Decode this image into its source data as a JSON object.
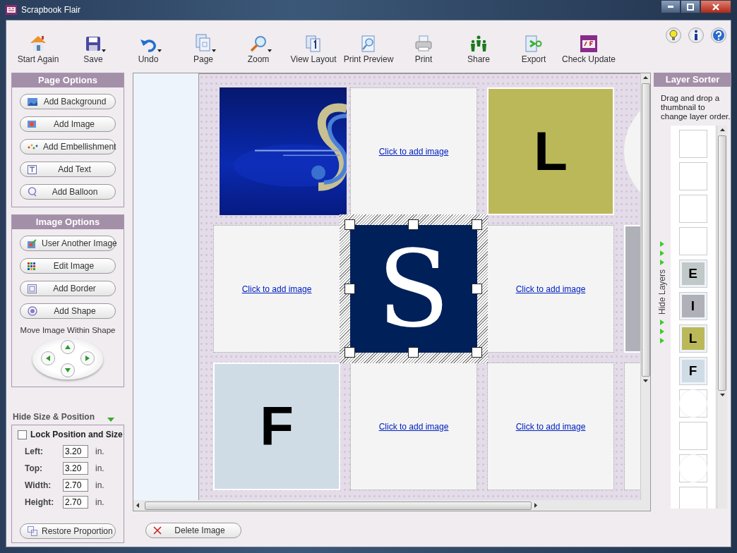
{
  "window": {
    "title": "Scrapbook Flair"
  },
  "toolbar": [
    {
      "label": "Start Again",
      "dropdown": false
    },
    {
      "label": "Save",
      "dropdown": true
    },
    {
      "label": "Undo",
      "dropdown": true
    },
    {
      "label": "Page",
      "dropdown": true
    },
    {
      "label": "Zoom",
      "dropdown": true
    },
    {
      "label": "View Layout",
      "dropdown": false
    },
    {
      "label": "Print Preview",
      "dropdown": false
    },
    {
      "label": "Print",
      "dropdown": false
    },
    {
      "label": "Share",
      "dropdown": false
    },
    {
      "label": "Export",
      "dropdown": false
    },
    {
      "label": "Check Update",
      "dropdown": false
    }
  ],
  "page_options": {
    "title": "Page Options",
    "buttons": [
      "Add Background",
      "Add Image",
      "Add Embellishment",
      "Add Text",
      "Add Balloon"
    ]
  },
  "image_options": {
    "title": "Image Options",
    "buttons": [
      "User Another Image",
      "Edit Image",
      "Add Border",
      "Add Shape"
    ],
    "move_label": "Move Image Within Shape"
  },
  "size_position": {
    "toggle_label": "Hide Size & Position",
    "lock": {
      "label": "Lock Position and Size",
      "checked": false
    },
    "fields": [
      {
        "label": "Left:",
        "value": "3.20",
        "unit": "in."
      },
      {
        "label": "Top:",
        "value": "3.20",
        "unit": "in."
      },
      {
        "label": "Width:",
        "value": "2.70",
        "unit": "in."
      },
      {
        "label": "Height:",
        "value": "2.70",
        "unit": "in."
      }
    ],
    "restore_button": "Restore Proportion"
  },
  "canvas": {
    "rows": [
      [
        {
          "kind": "picture",
          "selected": false
        },
        {
          "kind": "empty",
          "link": "Click to add image",
          "selected": false
        },
        {
          "kind": "letter",
          "letter": "L",
          "color": "#bbb85a",
          "selected": false
        },
        {
          "kind": "circle",
          "selected": false
        }
      ],
      [
        {
          "kind": "empty",
          "link": "Click to add image",
          "selected": false
        },
        {
          "kind": "monogram",
          "letter": "S",
          "color": "#00205a",
          "selected": true
        },
        {
          "kind": "empty",
          "link": "Click to add image",
          "selected": false
        },
        {
          "kind": "block",
          "color": "#b0b0b8",
          "selected": false
        }
      ],
      [
        {
          "kind": "letter",
          "letter": "F",
          "color": "#cfdce5",
          "selected": false
        },
        {
          "kind": "empty",
          "link": "Click to add image",
          "selected": false
        },
        {
          "kind": "empty",
          "link": "Click to add image",
          "selected": false
        },
        {
          "kind": "blank",
          "selected": false
        }
      ]
    ]
  },
  "delete_button": "Delete Image",
  "layer_sorter": {
    "title": "Layer Sorter",
    "hint": "Drag and drop a thumbnail to change layer order.",
    "hide_label": "Hide Layers",
    "layers": [
      {
        "kind": "blank"
      },
      {
        "kind": "blank"
      },
      {
        "kind": "blank"
      },
      {
        "kind": "blank"
      },
      {
        "kind": "letter",
        "letter": "E",
        "color": "#c0c8c8"
      },
      {
        "kind": "letter",
        "letter": "I",
        "color": "#b0b0b8"
      },
      {
        "kind": "letter",
        "letter": "L",
        "color": "#bbb85a"
      },
      {
        "kind": "letter",
        "letter": "F",
        "color": "#cfdce5"
      },
      {
        "kind": "circle"
      },
      {
        "kind": "blank"
      },
      {
        "kind": "circle"
      },
      {
        "kind": "blank"
      }
    ]
  }
}
